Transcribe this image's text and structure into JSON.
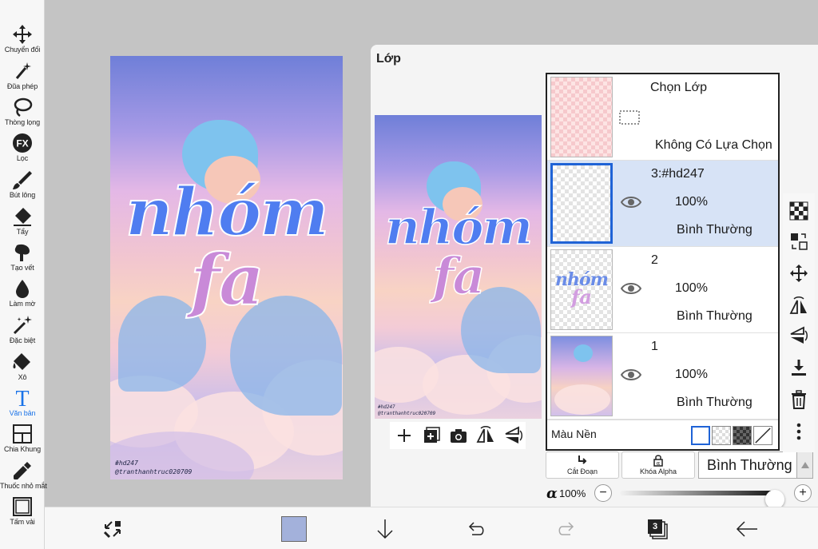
{
  "toolbar": {
    "tools": [
      {
        "label": "Chuyển đổi",
        "icon": "move-icon"
      },
      {
        "label": "Đũa phép",
        "icon": "magic-wand-icon"
      },
      {
        "label": "Thòng lọng",
        "icon": "lasso-icon"
      },
      {
        "label": "Lọc",
        "icon": "fx-filter-icon",
        "icon_text": "FX"
      },
      {
        "label": "Bút lông",
        "icon": "brush-icon"
      },
      {
        "label": "Tẩy",
        "icon": "eraser-icon"
      },
      {
        "label": "Tạo vết",
        "icon": "smudge-icon"
      },
      {
        "label": "Làm mờ",
        "icon": "blur-drop-icon"
      },
      {
        "label": "Đặc biệt",
        "icon": "special-pen-icon"
      },
      {
        "label": "Xô",
        "icon": "bucket-icon"
      },
      {
        "label": "Văn bản",
        "icon": "text-icon",
        "icon_text": "T",
        "active": true
      },
      {
        "label": "Chia Khung",
        "icon": "frame-divider-icon"
      },
      {
        "label": "Thuốc nhỏ mắt",
        "icon": "eyedropper-icon"
      },
      {
        "label": "Tấm vải",
        "icon": "canvas-icon"
      }
    ],
    "active_color": "#1a73e8"
  },
  "artwork": {
    "title_line1": "nhóm",
    "title_line2": "fa",
    "watermark_line1": "#hd247",
    "watermark_line2": "@tranthanhtruc020709"
  },
  "layer_panel": {
    "title": "Lớp",
    "selection_layer": {
      "name": "Chọn Lớp",
      "status": "Không Có Lựa Chọn"
    },
    "layers": [
      {
        "name": "3:#hd247",
        "opacity": "100%",
        "blend": "Bình Thường",
        "selected": true
      },
      {
        "name": "2",
        "opacity": "100%",
        "blend": "Bình Thường",
        "selected": false
      },
      {
        "name": "1",
        "opacity": "100%",
        "blend": "Bình Thường",
        "selected": false
      }
    ],
    "background_label": "Màu Nền",
    "clip_label": "Cắt Đoạn",
    "alpha_lock_label": "Khóa Alpha",
    "blend_mode": "Bình Thường",
    "alpha_symbol": "α",
    "alpha_value": "100%",
    "alpha_fraction": 1.0,
    "minus": "−",
    "plus": "+"
  },
  "bottombar": {
    "layer_count": "3",
    "current_color": "#a3b1db"
  },
  "colors": {
    "selected_layer_bg": "#d7e3f6",
    "selected_thumb_border": "#1f63d6"
  }
}
